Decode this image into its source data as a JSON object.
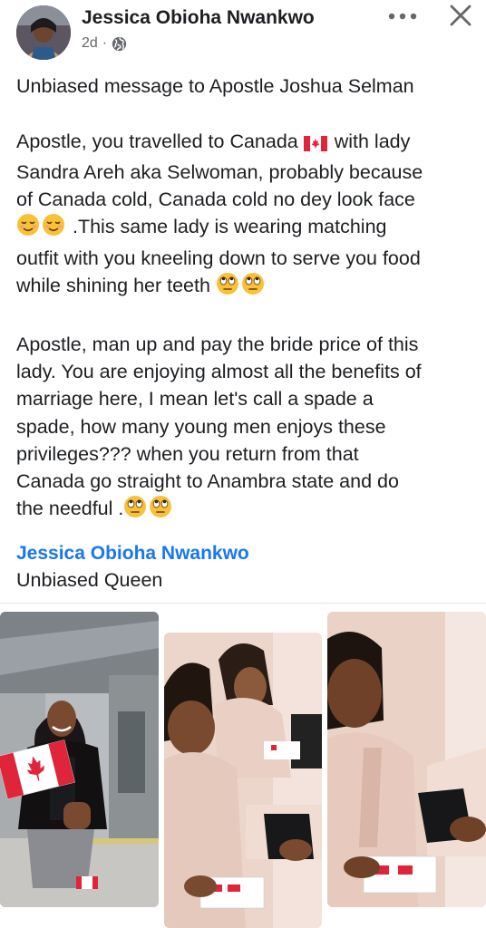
{
  "post": {
    "author": "Jessica Obioha Nwankwo",
    "time": "2d",
    "separator": "·",
    "privacy_icon": "globe-icon",
    "menu_icon": "more-horizontal-icon",
    "close_icon": "close-icon",
    "paragraphs": [
      {
        "lines": [
          {
            "text": "Unbiased message to Apostle Joshua Selman"
          }
        ]
      },
      {
        "lines": [
          {
            "text": "Apostle,  you travelled to Canada",
            "emoji_after": "canada-flag-emoji",
            "text2": " with lady"
          },
          {
            "text": "Sandra Areh aka Selwoman, probably because"
          },
          {
            "text": "of Canada cold, Canada  cold no dey look face"
          },
          {
            "emoji_before": [
              "relieved-face-emoji",
              "relieved-face-emoji"
            ],
            "text": " .This same lady is wearing matching"
          },
          {
            "text": "outfit with you kneeling down to serve you food"
          },
          {
            "text": "while shining her teeth ",
            "emoji_after2": [
              "eye-roll-emoji",
              "eye-roll-emoji"
            ]
          }
        ]
      },
      {
        "lines": [
          {
            "text": "Apostle, man up and pay the bride price of this"
          },
          {
            "text": "lady. You are enjoying almost all the benefits of"
          },
          {
            "text": "marriage here,  I mean let's call a spade a"
          },
          {
            "text": "spade,  how many young men enjoys these"
          },
          {
            "text": "privileges??? when you return from that"
          },
          {
            "text": "Canada go straight to Anambra state and do"
          },
          {
            "text": "the needful .",
            "emoji_after2": [
              "eye-roll-emoji",
              "eye-roll-emoji"
            ]
          }
        ]
      }
    ],
    "signature_name": "Jessica Obioha Nwankwo",
    "signature_title": "Unbiased Queen"
  },
  "photos": [
    {
      "name": "photo-woman-with-canada-flag"
    },
    {
      "name": "photo-women-at-table"
    },
    {
      "name": "photo-woman-serving-food"
    }
  ],
  "colors": {
    "link": "#1877f2",
    "text": "#1c1e21",
    "meta": "#65676b"
  }
}
